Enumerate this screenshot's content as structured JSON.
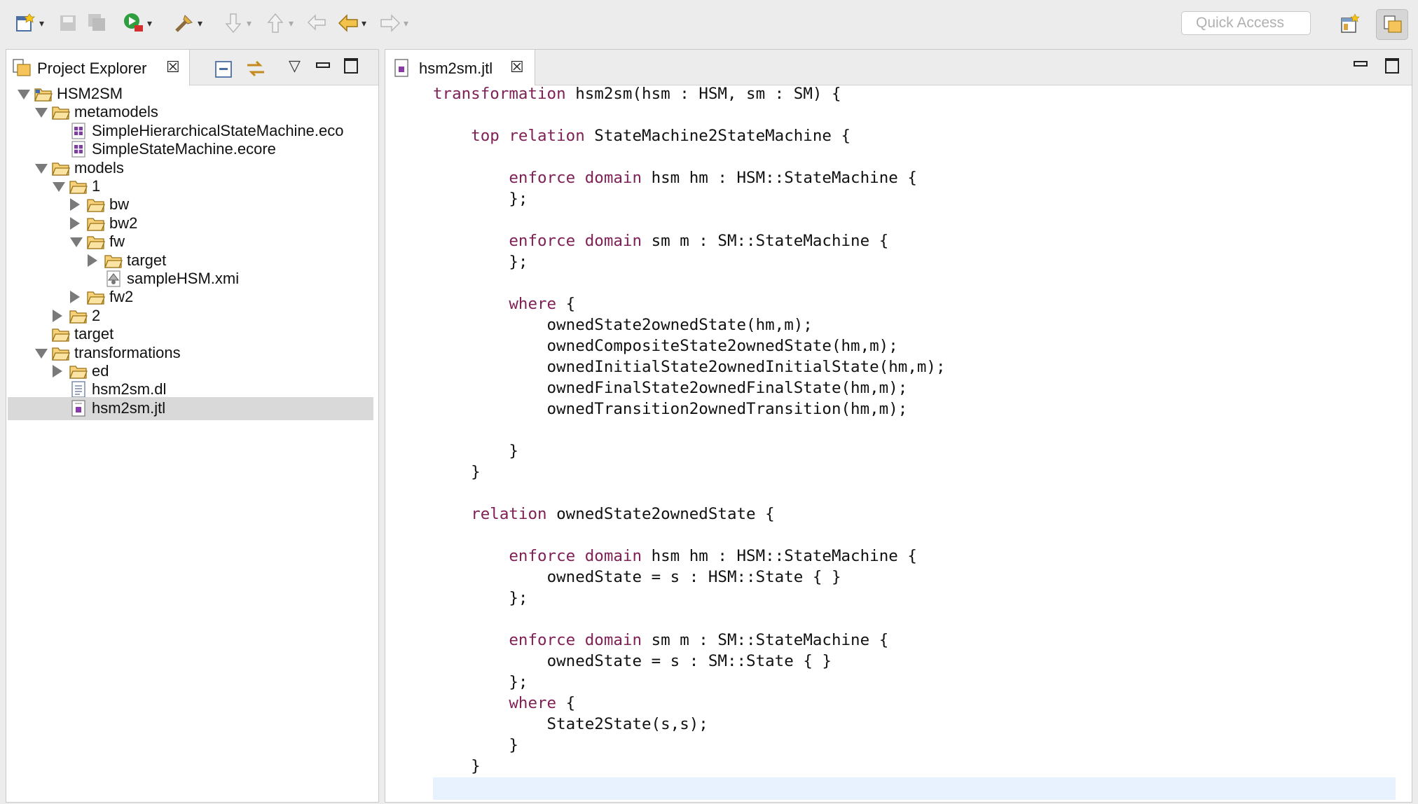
{
  "toolbar": {
    "quick_access_placeholder": "Quick Access"
  },
  "explorer": {
    "title": "Project Explorer",
    "tree": [
      {
        "label": "HSM2SM",
        "depth": 0,
        "expand": "open",
        "icon": "project-folder-icon"
      },
      {
        "label": "metamodels",
        "depth": 1,
        "expand": "open",
        "icon": "folder-icon"
      },
      {
        "label": "SimpleHierarchicalStateMachine.eco",
        "depth": 2,
        "expand": "none",
        "icon": "ecore-file-icon"
      },
      {
        "label": "SimpleStateMachine.ecore",
        "depth": 2,
        "expand": "none",
        "icon": "ecore-file-icon"
      },
      {
        "label": "models",
        "depth": 1,
        "expand": "open",
        "icon": "folder-icon"
      },
      {
        "label": "1",
        "depth": 2,
        "expand": "open",
        "icon": "folder-icon"
      },
      {
        "label": "bw",
        "depth": 3,
        "expand": "closed",
        "icon": "folder-icon"
      },
      {
        "label": "bw2",
        "depth": 3,
        "expand": "closed",
        "icon": "folder-icon"
      },
      {
        "label": "fw",
        "depth": 3,
        "expand": "open",
        "icon": "folder-icon"
      },
      {
        "label": "target",
        "depth": 4,
        "expand": "closed",
        "icon": "folder-icon"
      },
      {
        "label": "sampleHSM.xmi",
        "depth": 4,
        "expand": "none",
        "icon": "xmi-file-icon"
      },
      {
        "label": "fw2",
        "depth": 3,
        "expand": "closed",
        "icon": "folder-icon"
      },
      {
        "label": "2",
        "depth": 2,
        "expand": "closed",
        "icon": "folder-icon"
      },
      {
        "label": "target",
        "depth": 1,
        "expand": "none",
        "icon": "folder-icon"
      },
      {
        "label": "transformations",
        "depth": 1,
        "expand": "open",
        "icon": "folder-icon"
      },
      {
        "label": "ed",
        "depth": 2,
        "expand": "closed",
        "icon": "folder-icon"
      },
      {
        "label": "hsm2sm.dl",
        "depth": 2,
        "expand": "none",
        "icon": "text-file-icon"
      },
      {
        "label": "hsm2sm.jtl",
        "depth": 2,
        "expand": "none",
        "icon": "jtl-file-icon",
        "selected": true
      }
    ]
  },
  "editor": {
    "tab_label": "hsm2sm.jtl",
    "keywords": [
      "transformation",
      "top",
      "relation",
      "enforce",
      "domain",
      "where"
    ],
    "lines": [
      "transformation hsm2sm(hsm : HSM, sm : SM) {",
      "",
      "    top relation StateMachine2StateMachine {",
      "",
      "        enforce domain hsm hm : HSM::StateMachine {",
      "        };",
      "",
      "        enforce domain sm m : SM::StateMachine {",
      "        };",
      "",
      "        where {",
      "            ownedState2ownedState(hm,m);",
      "            ownedCompositeState2ownedState(hm,m);",
      "            ownedInitialState2ownedInitialState(hm,m);",
      "            ownedFinalState2ownedFinalState(hm,m);",
      "            ownedTransition2ownedTransition(hm,m);",
      "",
      "        }",
      "    }",
      "",
      "    relation ownedState2ownedState {",
      "",
      "        enforce domain hsm hm : HSM::StateMachine {",
      "            ownedState = s : HSM::State { }",
      "        };",
      "",
      "        enforce domain sm m : SM::StateMachine {",
      "            ownedState = s : SM::State { }",
      "        };",
      "        where {",
      "            State2State(s,s);",
      "        }",
      "    }"
    ]
  }
}
